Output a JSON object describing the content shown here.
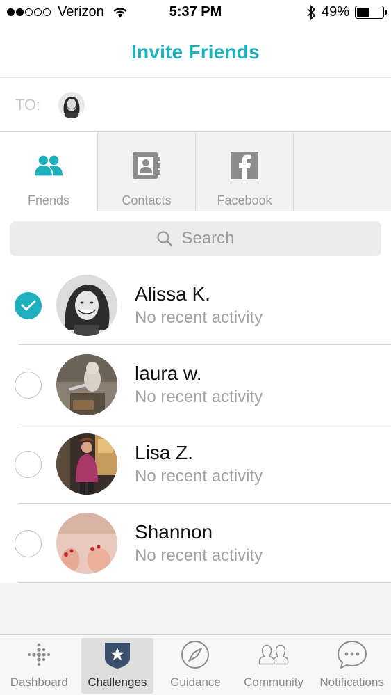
{
  "status_bar": {
    "carrier": "Verizon",
    "time": "5:37 PM",
    "battery": "49%",
    "battery_level": 0.49,
    "signal_bars": 2
  },
  "header": {
    "title": "Invite Friends"
  },
  "to_row": {
    "label": "TO:"
  },
  "tabs": [
    {
      "label": "Friends",
      "icon": "friends-icon",
      "active": true
    },
    {
      "label": "Contacts",
      "icon": "contacts-book-icon",
      "active": false
    },
    {
      "label": "Facebook",
      "icon": "facebook-icon",
      "active": false
    }
  ],
  "search": {
    "placeholder": "Search"
  },
  "friends": [
    {
      "name": "Alissa K.",
      "status": "No recent activity",
      "selected": true
    },
    {
      "name": "laura w.",
      "status": "No recent activity",
      "selected": false
    },
    {
      "name": "Lisa Z.",
      "status": "No recent activity",
      "selected": false
    },
    {
      "name": "Shannon",
      "status": "No recent activity",
      "selected": false
    }
  ],
  "tabbar": [
    {
      "label": "Dashboard",
      "icon": "dashboard-dots-icon",
      "active": false
    },
    {
      "label": "Challenges",
      "icon": "challenges-star-icon",
      "active": true
    },
    {
      "label": "Guidance",
      "icon": "compass-icon",
      "active": false
    },
    {
      "label": "Community",
      "icon": "community-icon",
      "active": false
    },
    {
      "label": "Notifications",
      "icon": "chat-bubble-icon",
      "active": false
    }
  ],
  "colors": {
    "accent": "#1eb1bd",
    "muted_text": "#a3a3a3",
    "tab_icon_inactive": "#8c8c8c"
  }
}
